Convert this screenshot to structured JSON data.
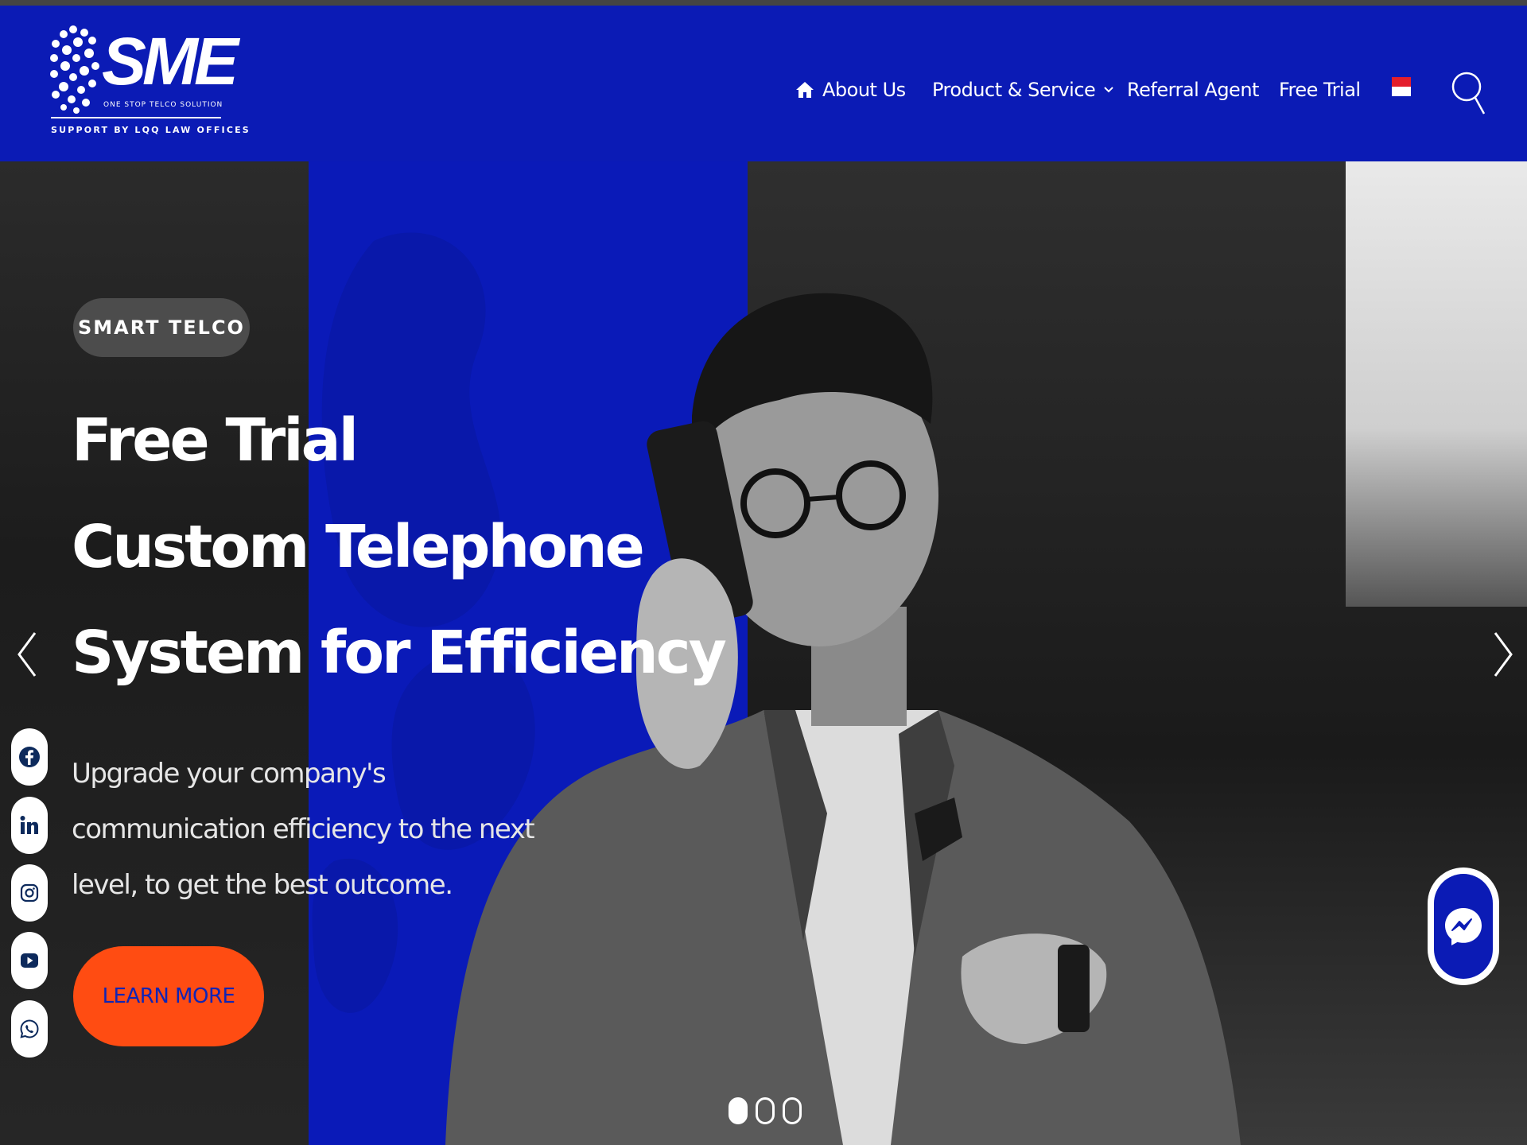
{
  "brand": {
    "name": "SME",
    "tagline": "ONE STOP TELCO SOLUTION",
    "support": "SUPPORT BY LQQ LAW OFFICES",
    "color_primary": "#0b1bb5",
    "color_accent": "#ff4c12"
  },
  "nav": {
    "items": [
      {
        "label": "About Us",
        "icon": "home-icon"
      },
      {
        "label": "Product & Service",
        "icon": "chevron-down-icon"
      },
      {
        "label": "Referral Agent"
      },
      {
        "label": "Free Trial"
      }
    ],
    "language_flag": "indonesia-flag-icon",
    "search_icon": "search-icon"
  },
  "hero": {
    "badge": "SMART TELCO",
    "headline": [
      "Free Trial",
      "Custom Telephone",
      "System for Efficiency"
    ],
    "description": "Upgrade your company's communication efficiency to the next level, to get the best outcome.",
    "cta_label": "LEARN MORE",
    "slides": {
      "count": 3,
      "active": 1
    }
  },
  "social": [
    "facebook-icon",
    "linkedin-icon",
    "instagram-icon",
    "youtube-icon",
    "whatsapp-icon"
  ],
  "chat_widget": "messenger-icon"
}
